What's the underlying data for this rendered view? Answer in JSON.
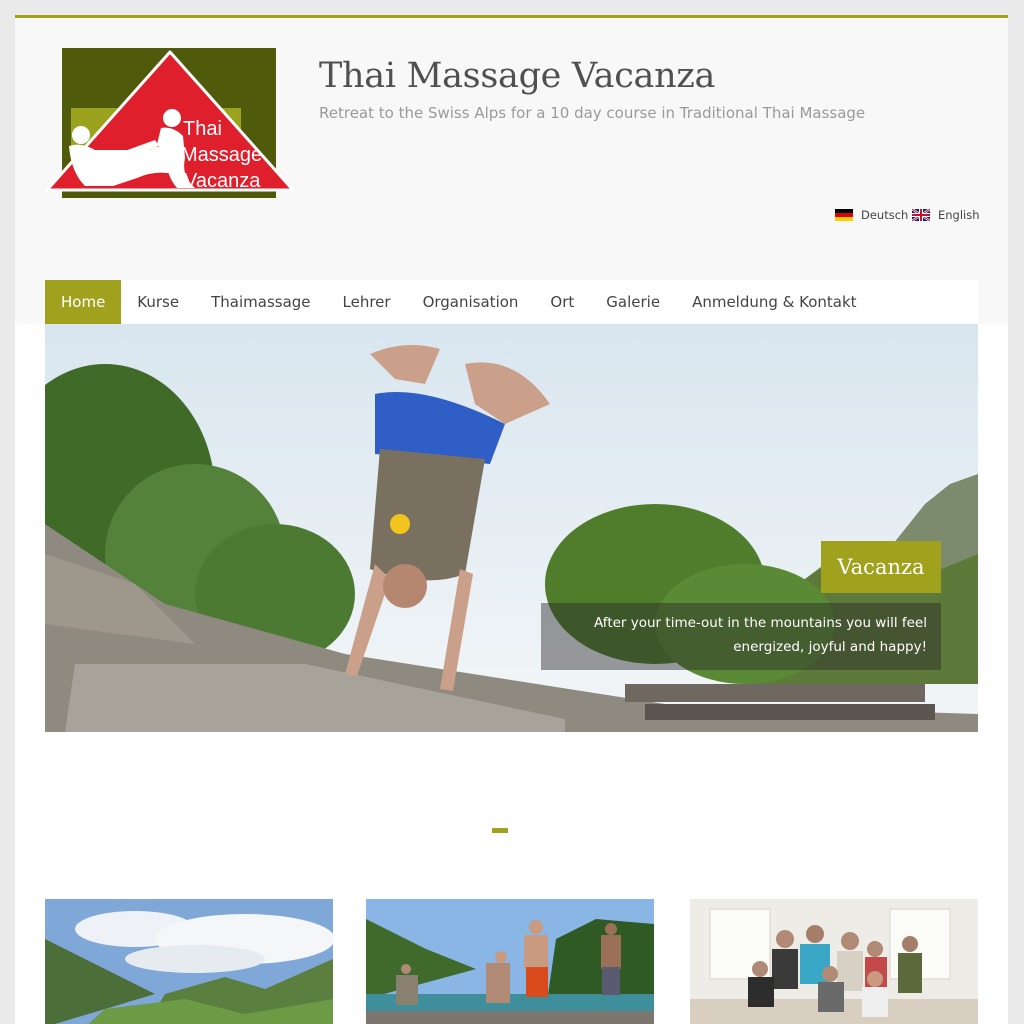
{
  "site": {
    "title": "Thai Massage Vacanza",
    "description": "Retreat to the Swiss Alps for a 10 day course in Traditional Thai Massage",
    "logo_text": [
      "Thai",
      "Massage",
      "Vacanza"
    ]
  },
  "languages": [
    {
      "label": "Deutsch",
      "flag": "de-flag-icon"
    },
    {
      "label": "English",
      "flag": "uk-flag-icon"
    }
  ],
  "nav": {
    "items": [
      {
        "label": "Home",
        "active": true
      },
      {
        "label": "Kurse",
        "active": false
      },
      {
        "label": "Thaimassage",
        "active": false
      },
      {
        "label": "Lehrer",
        "active": false
      },
      {
        "label": "Organisation",
        "active": false
      },
      {
        "label": "Ort",
        "active": false
      },
      {
        "label": "Galerie",
        "active": false
      },
      {
        "label": "Anmeldung & Kontakt",
        "active": false
      }
    ]
  },
  "hero": {
    "caption_title": "Vacanza",
    "caption_text": "After your time-out in the mountains you will feel energized, joyful and happy!"
  },
  "colors": {
    "accent": "#a0a21e",
    "logo_dark": "#4f5b0a",
    "logo_red": "#e01f2d"
  }
}
